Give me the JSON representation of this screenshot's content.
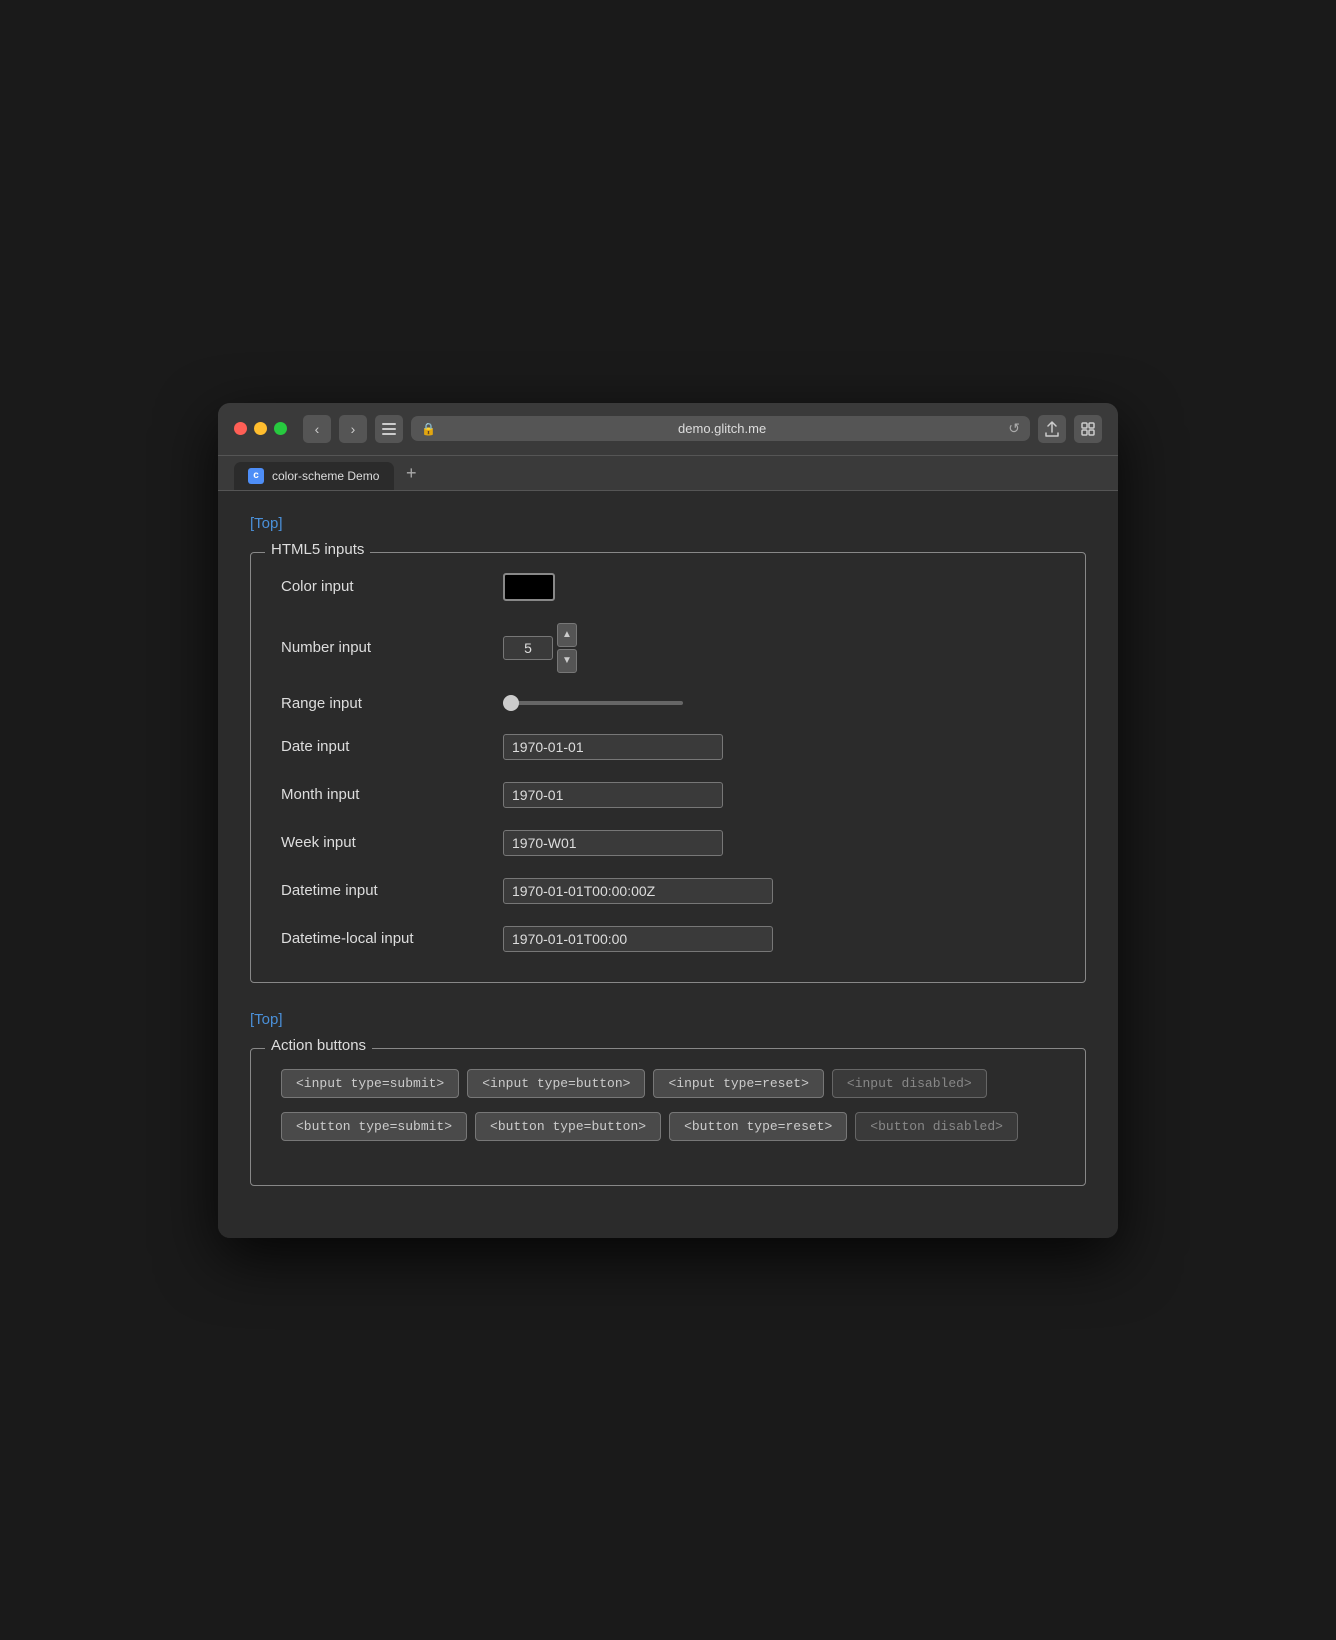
{
  "browser": {
    "address": "demo.glitch.me",
    "tab_title": "color-scheme Demo",
    "tab_favicon_letter": "c"
  },
  "top_link": "[Top]",
  "html5_section": {
    "legend": "HTML5 inputs",
    "fields": [
      {
        "label": "Color input",
        "type": "color",
        "value": "#000000"
      },
      {
        "label": "Number input",
        "type": "number",
        "value": "5"
      },
      {
        "label": "Range input",
        "type": "range",
        "value": "0"
      },
      {
        "label": "Date input",
        "type": "date",
        "value": "1970-01-01"
      },
      {
        "label": "Month input",
        "type": "month",
        "value": "1970-01"
      },
      {
        "label": "Week input",
        "type": "week",
        "value": "1970-W01"
      },
      {
        "label": "Datetime input",
        "type": "datetime",
        "value": "1970-01-01T00:00:00Z"
      },
      {
        "label": "Datetime-local input",
        "type": "datetime-local",
        "value": "1970-01-01T00:00"
      }
    ]
  },
  "bottom_link": "[Top]",
  "action_section": {
    "legend": "Action buttons",
    "input_buttons": [
      {
        "label": "<input type=submit>",
        "disabled": false
      },
      {
        "label": "<input type=button>",
        "disabled": false
      },
      {
        "label": "<input type=reset>",
        "disabled": false
      },
      {
        "label": "<input disabled>",
        "disabled": true
      }
    ],
    "button_buttons": [
      {
        "label": "<button type=submit>",
        "disabled": false
      },
      {
        "label": "<button type=button>",
        "disabled": false
      },
      {
        "label": "<button type=reset>",
        "disabled": false
      },
      {
        "label": "<button disabled>",
        "disabled": true
      }
    ]
  }
}
